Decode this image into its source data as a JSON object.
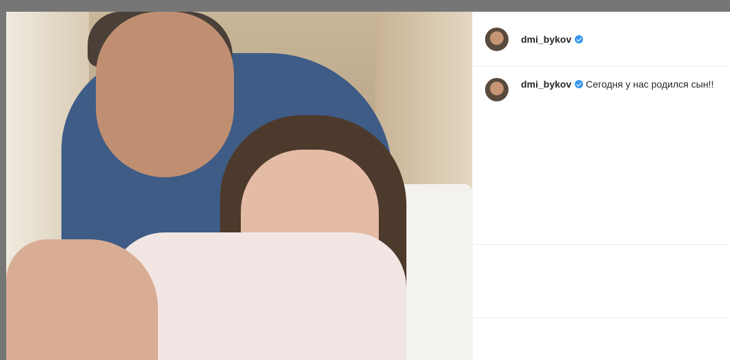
{
  "post": {
    "author": {
      "username": "dmi_bykov",
      "verified": true,
      "avatar_icon": "profile-photo"
    },
    "caption": {
      "username": "dmi_bykov",
      "verified": true,
      "text": "Сегодня у нас родился сын!!"
    },
    "media": {
      "type": "photo"
    }
  },
  "colors": {
    "backdrop": "#767676",
    "verified_badge": "#3897f0",
    "text": "#262626"
  }
}
